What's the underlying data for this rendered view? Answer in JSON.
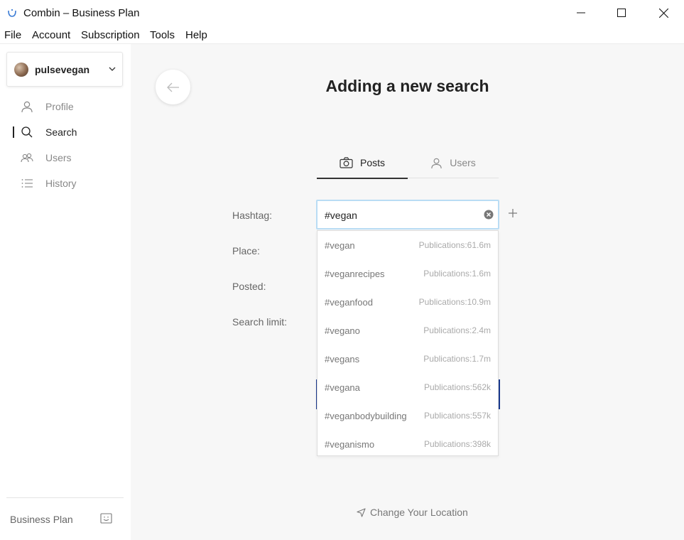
{
  "window": {
    "title": "Combin – Business Plan",
    "controls": [
      "minimize",
      "maximize",
      "close"
    ]
  },
  "menu": {
    "items": [
      "File",
      "Account",
      "Subscription",
      "Tools",
      "Help"
    ]
  },
  "sidebar": {
    "account_name": "pulsevegan",
    "nav": [
      {
        "label": "Profile",
        "icon": "user-icon",
        "active": false
      },
      {
        "label": "Search",
        "icon": "search-icon",
        "active": true
      },
      {
        "label": "Users",
        "icon": "users-icon",
        "active": false
      },
      {
        "label": "History",
        "icon": "list-icon",
        "active": false
      }
    ],
    "plan_label": "Business Plan"
  },
  "main": {
    "title": "Adding a new search",
    "tabs": [
      {
        "label": "Posts",
        "icon": "camera-icon",
        "active": true
      },
      {
        "label": "Users",
        "icon": "user-icon",
        "active": false
      }
    ],
    "fields": {
      "hashtag_label": "Hashtag:",
      "place_label": "Place:",
      "posted_label": "Posted:",
      "search_limit_label": "Search limit:"
    },
    "hashtag_value": "#vegan",
    "suggestions": [
      {
        "tag": "#vegan",
        "count": "Publications:61.6m"
      },
      {
        "tag": "#veganrecipes",
        "count": "Publications:1.6m"
      },
      {
        "tag": "#veganfood",
        "count": "Publications:10.9m"
      },
      {
        "tag": "#vegano",
        "count": "Publications:2.4m"
      },
      {
        "tag": "#vegans",
        "count": "Publications:1.7m"
      },
      {
        "tag": "#vegana",
        "count": "Publications:562k"
      },
      {
        "tag": "#veganbodybuilding",
        "count": "Publications:557k"
      },
      {
        "tag": "#veganismo",
        "count": "Publications:398k"
      }
    ],
    "location_link": "Change Your Location"
  },
  "colors": {
    "input_focus_border": "#b9dcf4",
    "main_background": "#f7f7f7",
    "accent_dark": "#1a3a8f"
  }
}
